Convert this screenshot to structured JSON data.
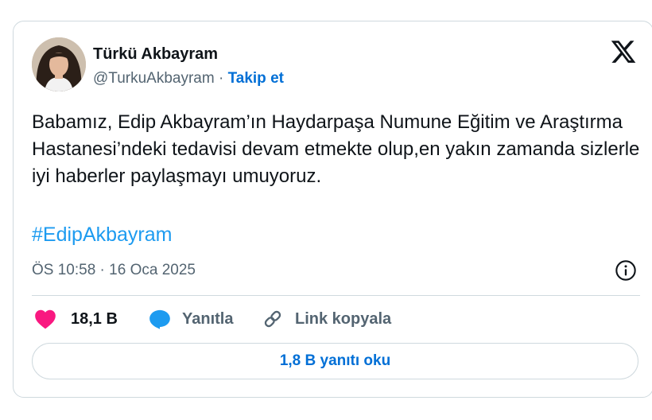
{
  "author": {
    "name": "Türkü Akbayram",
    "handle": "@TurkuAkbayram",
    "separator": " · ",
    "follow_label": "Takip et"
  },
  "tweet": {
    "text": "Babamız, Edip Akbayram’ın Haydarpaşa Numune Eğitim ve Araştırma Hastanesi’ndeki tedavisi devam etmekte olup,en yakın zamanda sizlerle iyi haberler paylaşmayı umuyoruz.",
    "hashtag": "#EdipAkbayram",
    "timestamp": "ÖS 10:58 · 16 Oca 2025"
  },
  "actions": {
    "likes": "18,1 B",
    "reply_label": "Yanıtla",
    "copy_link_label": "Link kopyala"
  },
  "read_replies_label": "1,8 B yanıtı oku",
  "colors": {
    "accent": "#1d9bf0",
    "link_blue": "#006fd6",
    "like_pink": "#f91880",
    "muted": "#536471",
    "border": "#cfd9de"
  },
  "icons": [
    "avatar",
    "x-logo-icon",
    "info-icon",
    "heart-icon",
    "reply-bubble-icon",
    "link-icon"
  ]
}
